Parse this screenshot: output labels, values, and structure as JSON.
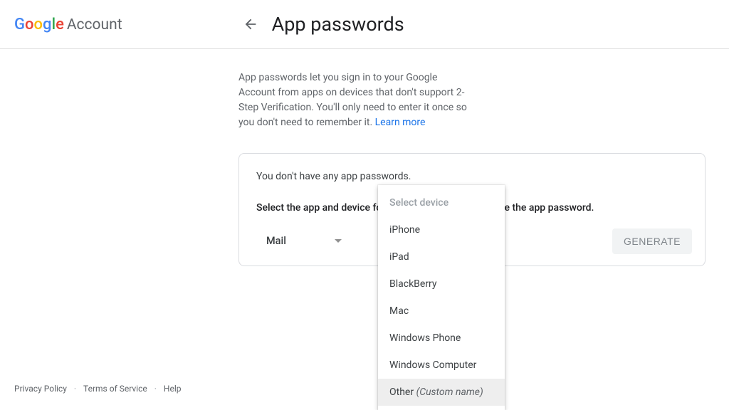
{
  "header": {
    "logo_account": "Account",
    "page_title": "App passwords"
  },
  "main": {
    "description": "App passwords let you sign in to your Google Account from apps on devices that don't support 2-Step Verification. You'll only need to enter it once so you don't need to remember it. ",
    "learn_more": "Learn more",
    "no_passwords": "You don't have any app passwords.",
    "select_instruction": "Select the app and device for which you want to generate the app password.",
    "app_selector": {
      "selected": "Mail"
    },
    "generate_button": "GENERATE"
  },
  "device_dropdown": {
    "placeholder": "Select device",
    "options": [
      {
        "label": "iPhone"
      },
      {
        "label": "iPad"
      },
      {
        "label": "BlackBerry"
      },
      {
        "label": "Mac"
      },
      {
        "label": "Windows Phone"
      },
      {
        "label": "Windows Computer"
      },
      {
        "label_prefix": "Other ",
        "label_custom": "(Custom name)",
        "highlight": true
      }
    ]
  },
  "footer": {
    "privacy": "Privacy Policy",
    "terms": "Terms of Service",
    "help": "Help"
  }
}
